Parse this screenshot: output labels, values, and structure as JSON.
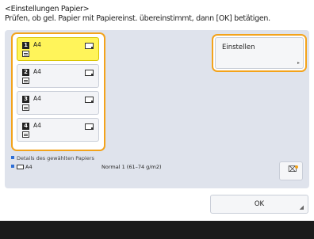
{
  "header": {
    "title": "<Einstellungen Papier>",
    "instruction": "Prüfen, ob gel. Papier mit Papiereinst. übereinstimmt, dann [OK] betätigen."
  },
  "trays": [
    {
      "number": "1",
      "size": "A4",
      "selected": true
    },
    {
      "number": "2",
      "size": "A4",
      "selected": false
    },
    {
      "number": "3",
      "size": "A4",
      "selected": false
    },
    {
      "number": "4",
      "size": "A4",
      "selected": false
    }
  ],
  "settings_button": {
    "label": "Einstellen"
  },
  "details": {
    "label": "Details des gewählten Papiers",
    "size": "A4",
    "type": "Normal 1 (61–74 g/m2)"
  },
  "ok_button": {
    "label": "OK"
  },
  "icons": {
    "tray_paper": "paper-sheet-icon",
    "tray_stack": "paper-stack-icon",
    "details_paper": "paper-size-icon",
    "settings_tool": "paper-settings-icon"
  },
  "colors": {
    "highlight": "#f3a31b",
    "selected_tray": "#fff45a",
    "panel": "#dfe3ec"
  }
}
